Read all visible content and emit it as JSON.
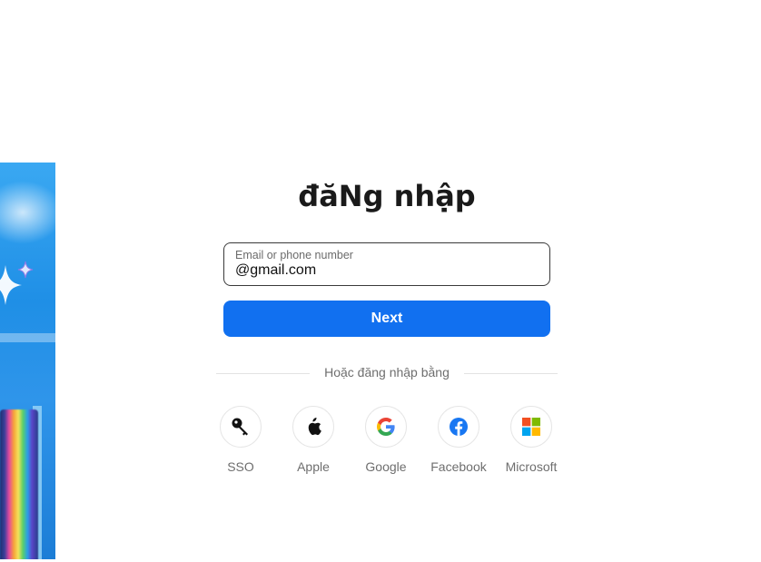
{
  "login": {
    "title": "đăNg nhập",
    "email_field": {
      "label": "Email or phone number",
      "value": "@gmail.com"
    },
    "next_label": "Next",
    "divider_text": "Hoặc đăng nhập bằng",
    "providers": [
      {
        "label": "SSO",
        "icon": "key-icon"
      },
      {
        "label": "Apple",
        "icon": "apple-icon"
      },
      {
        "label": "Google",
        "icon": "google-icon"
      },
      {
        "label": "Facebook",
        "icon": "facebook-icon"
      },
      {
        "label": "Microsoft",
        "icon": "microsoft-icon"
      }
    ]
  },
  "colors": {
    "primary": "#1170f0",
    "facebook": "#1877f2",
    "text_muted": "#6e6e6e"
  }
}
